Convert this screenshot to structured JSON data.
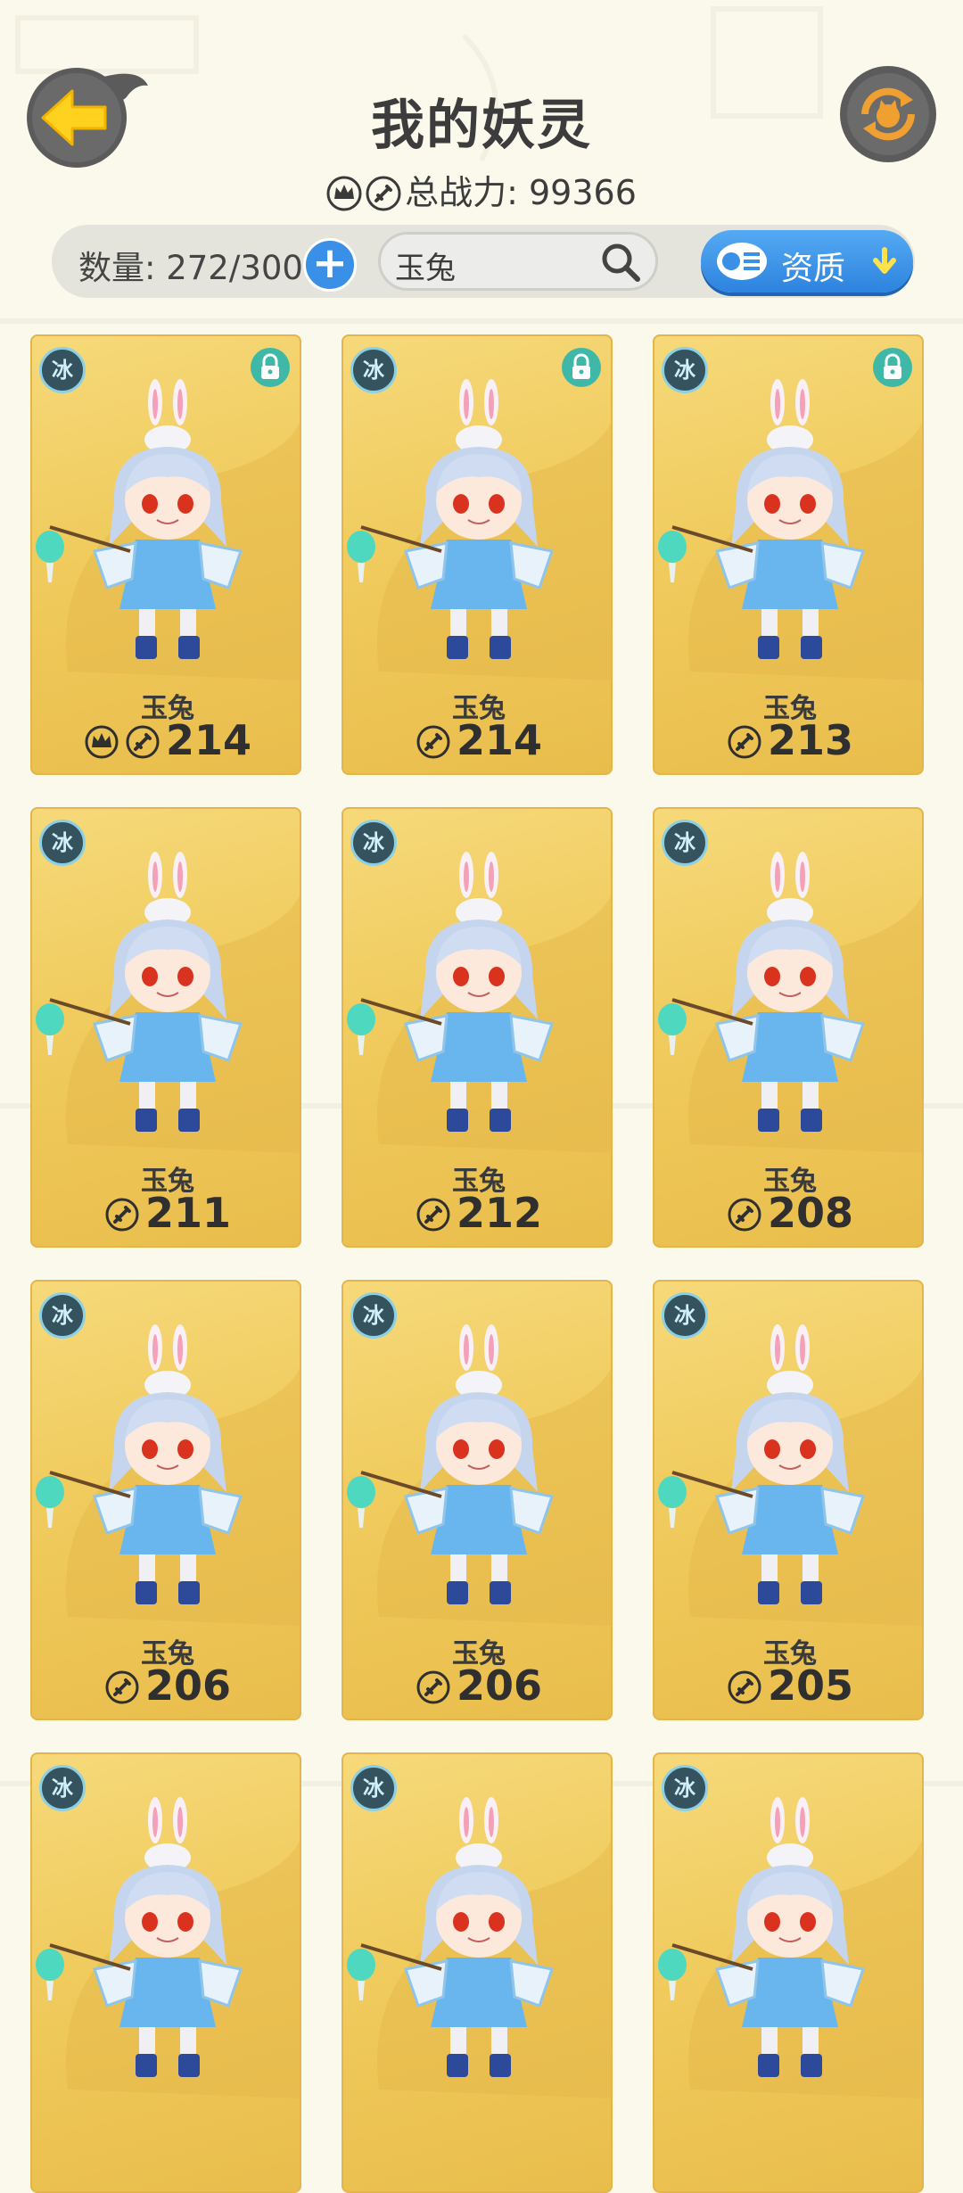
{
  "header": {
    "title": "我的妖灵",
    "total_power_label": "总战力: 99366",
    "back_icon": "back-arrow-icon",
    "refresh_icon": "refresh-icon"
  },
  "toolbar": {
    "count_label": "数量: 272/300",
    "add_icon": "plus-icon",
    "search_value": "玉兔",
    "sort_label": "资质"
  },
  "colors": {
    "card_gold": "#f0cb5d",
    "accent_blue": "#3a8fe6",
    "lock_green": "#3fb8a8",
    "refresh_orange": "#f0a030"
  },
  "cards": [
    {
      "name": "玉兔",
      "power": "214",
      "element": "冰",
      "locked": true,
      "crown": true
    },
    {
      "name": "玉兔",
      "power": "214",
      "element": "冰",
      "locked": true,
      "crown": false
    },
    {
      "name": "玉兔",
      "power": "213",
      "element": "冰",
      "locked": true,
      "crown": false
    },
    {
      "name": "玉兔",
      "power": "211",
      "element": "冰",
      "locked": false,
      "crown": false
    },
    {
      "name": "玉兔",
      "power": "212",
      "element": "冰",
      "locked": false,
      "crown": false
    },
    {
      "name": "玉兔",
      "power": "208",
      "element": "冰",
      "locked": false,
      "crown": false
    },
    {
      "name": "玉兔",
      "power": "206",
      "element": "冰",
      "locked": false,
      "crown": false
    },
    {
      "name": "玉兔",
      "power": "206",
      "element": "冰",
      "locked": false,
      "crown": false
    },
    {
      "name": "玉兔",
      "power": "205",
      "element": "冰",
      "locked": false,
      "crown": false
    },
    {
      "name": "",
      "power": "",
      "element": "冰",
      "locked": false,
      "crown": false
    },
    {
      "name": "",
      "power": "",
      "element": "冰",
      "locked": false,
      "crown": false
    },
    {
      "name": "",
      "power": "",
      "element": "冰",
      "locked": false,
      "crown": false
    }
  ]
}
